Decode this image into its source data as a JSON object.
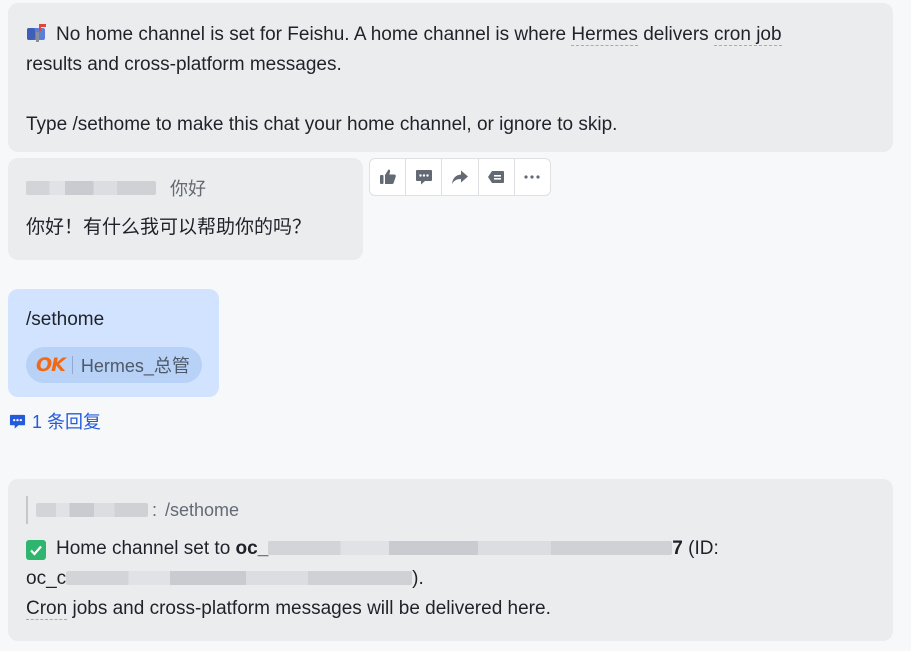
{
  "colors": {
    "bubble_gray": "#ebecee",
    "bubble_blue": "#d1e3ff",
    "link_blue": "#245bdb",
    "check_green": "#2eb66f",
    "ok_orange": "#f06a16"
  },
  "notice": {
    "icon": "mailbox-icon",
    "text_a": "No home channel is set for Feishu. A home channel is where ",
    "hermes": "Hermes",
    "text_b": " delivers ",
    "cron_job": "cron job",
    "line2": "results and cross-platform messages.",
    "line3": "Type /sethome to make this chat your home channel, or ignore to skip."
  },
  "reply_message": {
    "quoted_text": "你好",
    "body": "你好！有什么我可以帮助你的吗？"
  },
  "toolbar": {
    "icons": [
      "thumbs-up-icon",
      "comment-icon",
      "forward-icon",
      "pin-icon",
      "more-icon"
    ]
  },
  "user_message": {
    "body": "/sethome",
    "reaction_emoji": "OK",
    "reaction_user": "Hermes_总管"
  },
  "thread": {
    "label": "1 条回复"
  },
  "confirm_message": {
    "quoted_text": "/sethome",
    "line1_prefix": "Home channel set to ",
    "line1_code": "oc_",
    "line1_code_end": "7",
    "line1_suffix": " (ID:",
    "line2_prefix": "oc_c",
    "line2_suffix": ").",
    "cron": "Cron",
    "line3_rest": " jobs and cross-platform messages will be delivered here."
  }
}
